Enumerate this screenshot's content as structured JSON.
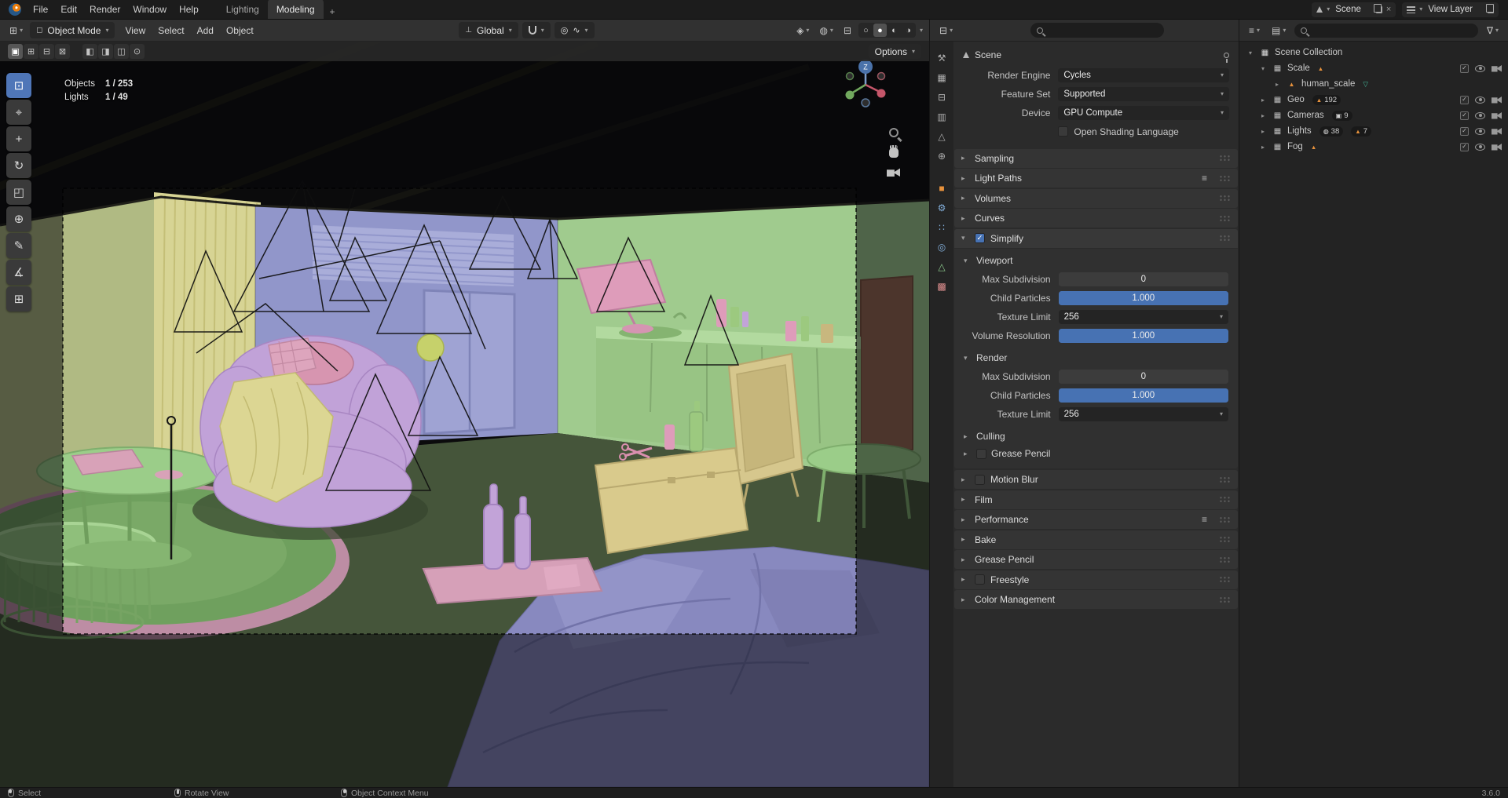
{
  "colors": {
    "accent": "#4772b3",
    "selection_orange": "#e8923c"
  },
  "topbar": {
    "menus": [
      {
        "label": "File"
      },
      {
        "label": "Edit"
      },
      {
        "label": "Render"
      },
      {
        "label": "Window"
      },
      {
        "label": "Help"
      }
    ],
    "workspaces": [
      {
        "label": "Lighting",
        "state": ""
      },
      {
        "label": "Modeling",
        "state": "active"
      }
    ],
    "new_workspace_label": "+",
    "scene_widget": {
      "label": "Scene"
    },
    "view_layer_widget": {
      "label": "View Layer"
    }
  },
  "viewport": {
    "header": {
      "mode": "Object Mode",
      "menus": [
        {
          "label": "View"
        },
        {
          "label": "Select"
        },
        {
          "label": "Add"
        },
        {
          "label": "Object"
        }
      ],
      "orientation": "Global",
      "options_label": "Options"
    },
    "stats": [
      {
        "label": "Objects",
        "value": "1 / 253"
      },
      {
        "label": "Lights",
        "value": "1 / 49"
      }
    ],
    "gizmo_axis_label": "Z",
    "tools": [
      {
        "name": "select-box",
        "glyph": "⊡",
        "state": "active"
      },
      {
        "name": "cursor",
        "glyph": "⌖",
        "state": ""
      },
      {
        "name": "move",
        "glyph": "+",
        "state": ""
      },
      {
        "name": "rotate",
        "glyph": "↻",
        "state": ""
      },
      {
        "name": "scale",
        "glyph": "◰",
        "state": ""
      },
      {
        "name": "transform",
        "glyph": "⊕",
        "state": ""
      },
      {
        "name": "annotate",
        "glyph": "✎",
        "state": ""
      },
      {
        "name": "measure",
        "glyph": "∡",
        "state": ""
      },
      {
        "name": "add-cube",
        "glyph": "⊞",
        "state": ""
      }
    ],
    "select_modes": [
      {
        "glyph": "▣",
        "state": "active"
      },
      {
        "glyph": "⊞",
        "state": ""
      },
      {
        "glyph": "⊟",
        "state": ""
      },
      {
        "glyph": "⊠",
        "state": ""
      }
    ],
    "tool_options": [
      {
        "glyph": "◧"
      },
      {
        "glyph": "◨"
      },
      {
        "glyph": "◫"
      },
      {
        "glyph": "⊙"
      }
    ],
    "shading_modes": [
      {
        "name": "wireframe",
        "glyph": "○",
        "state": ""
      },
      {
        "name": "solid",
        "glyph": "●",
        "state": "active"
      },
      {
        "name": "material-preview",
        "glyph": "◐",
        "state": ""
      },
      {
        "name": "rendered",
        "glyph": "◑",
        "state": ""
      }
    ]
  },
  "properties": {
    "tabs": [
      {
        "name": "tool",
        "glyph": "⚒",
        "state": ""
      },
      {
        "name": "render",
        "glyph": "▦",
        "state": ""
      },
      {
        "name": "output",
        "glyph": "⊟",
        "state": ""
      },
      {
        "name": "view-layer",
        "glyph": "▥",
        "state": ""
      },
      {
        "name": "scene",
        "glyph": "△",
        "state": "active"
      },
      {
        "name": "world",
        "glyph": "⊕",
        "state": ""
      },
      {
        "name": "object",
        "glyph": "■",
        "state": ""
      },
      {
        "name": "modifiers",
        "glyph": "⚙",
        "state": ""
      },
      {
        "name": "particles",
        "glyph": "∷",
        "state": ""
      },
      {
        "name": "physics",
        "glyph": "◎",
        "state": ""
      },
      {
        "name": "object-data",
        "glyph": "△",
        "state": ""
      },
      {
        "name": "texture",
        "glyph": "▩",
        "state": ""
      }
    ],
    "breadcrumb": "Scene",
    "engine": {
      "label": "Render Engine",
      "value": "Cycles"
    },
    "feature_set": {
      "label": "Feature Set",
      "value": "Supported"
    },
    "device": {
      "label": "Device",
      "value": "GPU Compute"
    },
    "osl_label": "Open Shading Language",
    "panels_top": [
      {
        "title": "Sampling",
        "arrow": "▸",
        "cb": "none",
        "preset": "hide"
      },
      {
        "title": "Light Paths",
        "arrow": "▸",
        "cb": "none",
        "preset": "show"
      },
      {
        "title": "Volumes",
        "arrow": "▸",
        "cb": "none",
        "preset": "hide"
      },
      {
        "title": "Curves",
        "arrow": "▸",
        "cb": "none",
        "preset": "hide"
      }
    ],
    "simplify": {
      "title": "Simplify",
      "arrow": "▾",
      "viewport_title": "Viewport",
      "viewport_arrow": "▾",
      "viewport_rows": [
        {
          "label": "Max Subdivision",
          "value": "0",
          "type": "num"
        },
        {
          "label": "Child Particles",
          "value": "1.000",
          "type": "slider"
        },
        {
          "label": "Texture Limit",
          "value": "256",
          "type": "menu"
        },
        {
          "label": "Volume Resolution",
          "value": "1.000",
          "type": "slider"
        }
      ],
      "render_title": "Render",
      "render_arrow": "▾",
      "render_rows": [
        {
          "label": "Max Subdivision",
          "value": "0",
          "type": "num"
        },
        {
          "label": "Child Particles",
          "value": "1.000",
          "type": "slider"
        },
        {
          "label": "Texture Limit",
          "value": "256",
          "type": "menu"
        }
      ],
      "subpanels": [
        {
          "title": "Culling",
          "arrow": "▸",
          "cb": "none"
        },
        {
          "title": "Grease Pencil",
          "arrow": "▸",
          "cb": "unchecked"
        }
      ]
    },
    "panels_bottom": [
      {
        "title": "Motion Blur",
        "arrow": "▸",
        "cb": "unchecked",
        "preset": "hide"
      },
      {
        "title": "Film",
        "arrow": "▸",
        "cb": "none",
        "preset": "hide"
      },
      {
        "title": "Performance",
        "arrow": "▸",
        "cb": "none",
        "preset": "show"
      },
      {
        "title": "Bake",
        "arrow": "▸",
        "cb": "none",
        "preset": "hide"
      },
      {
        "title": "Grease Pencil",
        "arrow": "▸",
        "cb": "none",
        "preset": "hide"
      },
      {
        "title": "Freestyle",
        "arrow": "▸",
        "cb": "unchecked",
        "preset": "hide"
      },
      {
        "title": "Color Management",
        "arrow": "▸",
        "cb": "none",
        "preset": "hide"
      }
    ]
  },
  "outliner": {
    "rows": [
      {
        "ind": "i0",
        "arrow": "▾",
        "icon": "colmain",
        "name": "Scene Collection",
        "right": "hide",
        "b1": "none",
        "b1t": "",
        "b2": "none",
        "b2t": ""
      },
      {
        "ind": "i1",
        "arrow": "▾",
        "icon": "col",
        "name": "Scale",
        "right": "show",
        "b1": "tri",
        "b1t": "",
        "b2": "none",
        "b2t": ""
      },
      {
        "ind": "i2",
        "arrow": "▸",
        "icon": "mesh",
        "name": "human_scale",
        "right": "hide",
        "b1": "mod",
        "b1t": "",
        "b2": "none",
        "b2t": ""
      },
      {
        "ind": "i1",
        "arrow": "▸",
        "icon": "col",
        "name": "Geo",
        "right": "show",
        "b1": "trin",
        "b1t": "192",
        "b2": "none",
        "b2t": ""
      },
      {
        "ind": "i1",
        "arrow": "▸",
        "icon": "col",
        "name": "Cameras",
        "right": "show",
        "b1": "camn",
        "b1t": "9",
        "b2": "none",
        "b2t": ""
      },
      {
        "ind": "i1",
        "arrow": "▸",
        "icon": "col",
        "name": "Lights",
        "right": "show",
        "b1": "bulbn",
        "b1t": "38",
        "b2": "trin",
        "b2t": "7"
      },
      {
        "ind": "i1",
        "arrow": "▸",
        "icon": "col",
        "name": "Fog",
        "right": "show",
        "b1": "tri",
        "b1t": "",
        "b2": "none",
        "b2t": ""
      }
    ]
  },
  "statusbar": {
    "items": [
      {
        "icon": "mouse-left",
        "label": "Select"
      },
      {
        "icon": "mouse-middle",
        "label": "Rotate View"
      },
      {
        "icon": "mouse-right",
        "label": "Object Context Menu"
      }
    ],
    "version": "3.6.0"
  }
}
